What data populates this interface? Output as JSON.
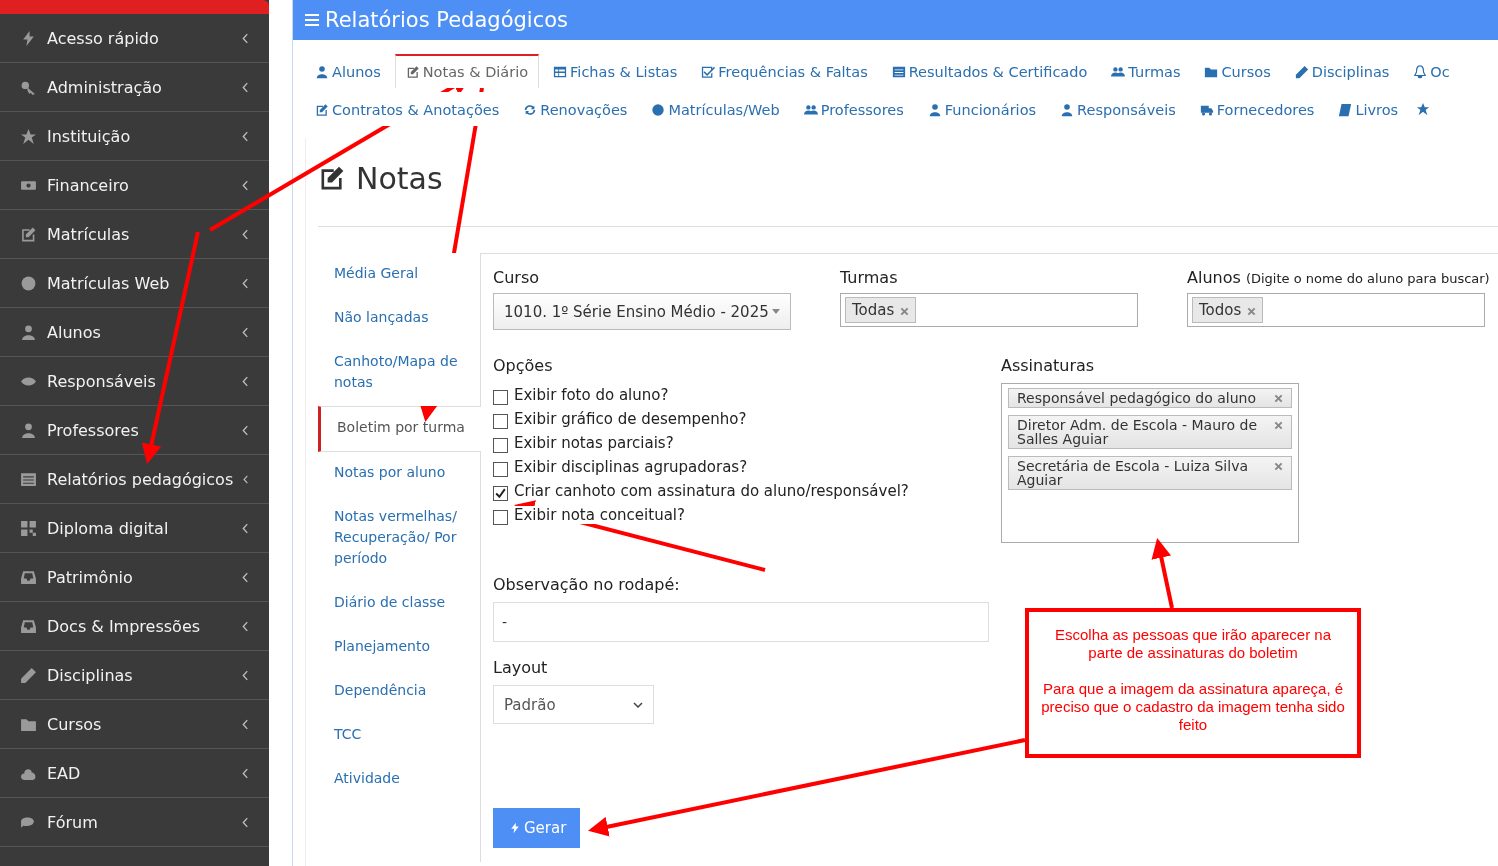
{
  "sidebar": {
    "items": [
      {
        "label": "Acesso rápido"
      },
      {
        "label": "Administração"
      },
      {
        "label": "Instituição"
      },
      {
        "label": "Financeiro"
      },
      {
        "label": "Matrículas"
      },
      {
        "label": "Matrículas Web"
      },
      {
        "label": "Alunos"
      },
      {
        "label": "Responsáveis"
      },
      {
        "label": "Professores"
      },
      {
        "label": "Relatórios pedagógicos"
      },
      {
        "label": "Diploma digital"
      },
      {
        "label": "Patrimônio"
      },
      {
        "label": "Docs & Impressões"
      },
      {
        "label": "Disciplinas"
      },
      {
        "label": "Cursos"
      },
      {
        "label": "EAD"
      },
      {
        "label": "Fórum"
      }
    ]
  },
  "header": {
    "title": "Relatórios Pedagógicos"
  },
  "tabs": [
    {
      "label": "Alunos",
      "selected": false
    },
    {
      "label": "Notas & Diário",
      "selected": true
    },
    {
      "label": "Fichas & Listas",
      "selected": false
    },
    {
      "label": "Frequências & Faltas",
      "selected": false
    },
    {
      "label": "Resultados & Certificado",
      "selected": false
    },
    {
      "label": "Turmas",
      "selected": false
    },
    {
      "label": "Cursos",
      "selected": false
    },
    {
      "label": "Disciplinas",
      "selected": false
    },
    {
      "label": "Oc",
      "selected": false
    },
    {
      "label": "Contratos & Anotações",
      "selected": false
    },
    {
      "label": "Renovações",
      "selected": false
    },
    {
      "label": "Matrículas/Web",
      "selected": false
    },
    {
      "label": "Professores",
      "selected": false
    },
    {
      "label": "Funcionários",
      "selected": false
    },
    {
      "label": "Responsáveis",
      "selected": false
    },
    {
      "label": "Fornecedores",
      "selected": false
    },
    {
      "label": "Livros",
      "selected": false
    }
  ],
  "page": {
    "title": "Notas"
  },
  "subnav": [
    {
      "label": "Média Geral",
      "selected": false
    },
    {
      "label": "Não lançadas",
      "selected": false
    },
    {
      "label": "Canhoto/Mapa de notas",
      "selected": false
    },
    {
      "label": "Boletim por turma",
      "selected": true
    },
    {
      "label": "Notas por aluno",
      "selected": false
    },
    {
      "label": "Notas vermelhas/ Recuperação/ Por período",
      "selected": false
    },
    {
      "label": "Diário de classe",
      "selected": false
    },
    {
      "label": "Planejamento",
      "selected": false
    },
    {
      "label": "Dependência",
      "selected": false
    },
    {
      "label": "TCC",
      "selected": false
    },
    {
      "label": "Atividade",
      "selected": false
    }
  ],
  "form": {
    "curso": {
      "label": "Curso",
      "value": "1010. 1º Série Ensino Médio - 2025"
    },
    "turmas": {
      "label": "Turmas",
      "tags": [
        "Todas"
      ]
    },
    "alunos": {
      "label": "Alunos",
      "hint": "(Digite o nome do aluno para buscar)",
      "tags": [
        "Todos"
      ]
    },
    "opcoes": {
      "label": "Opções",
      "items": [
        {
          "label": "Exibir foto do aluno?",
          "checked": false
        },
        {
          "label": "Exibir gráfico de desempenho?",
          "checked": false
        },
        {
          "label": "Exibir notas parciais?",
          "checked": false
        },
        {
          "label": "Exibir disciplinas agrupadoras?",
          "checked": false
        },
        {
          "label": "Criar canhoto com assinatura do aluno/responsável?",
          "checked": true
        },
        {
          "label": "Exibir nota conceitual?",
          "checked": false
        }
      ]
    },
    "assinaturas": {
      "label": "Assinaturas",
      "tags": [
        "Responsável pedagógico do aluno",
        "Diretor Adm. de Escola - Mauro de Salles Aguiar",
        "Secretária de Escola - Luiza Silva Aguiar"
      ]
    },
    "observacao": {
      "label": "Observação no rodapé:",
      "value": "-"
    },
    "layout": {
      "label": "Layout",
      "value": "Padrão"
    },
    "submit": "Gerar"
  },
  "callout": {
    "paragraphs": [
      "Escolha as pessoas que irão aparecer na parte de assinaturas do boletim",
      "Para que a imagem da assinatura apareça, é preciso que o cadastro da imagem tenha sido feito"
    ]
  }
}
